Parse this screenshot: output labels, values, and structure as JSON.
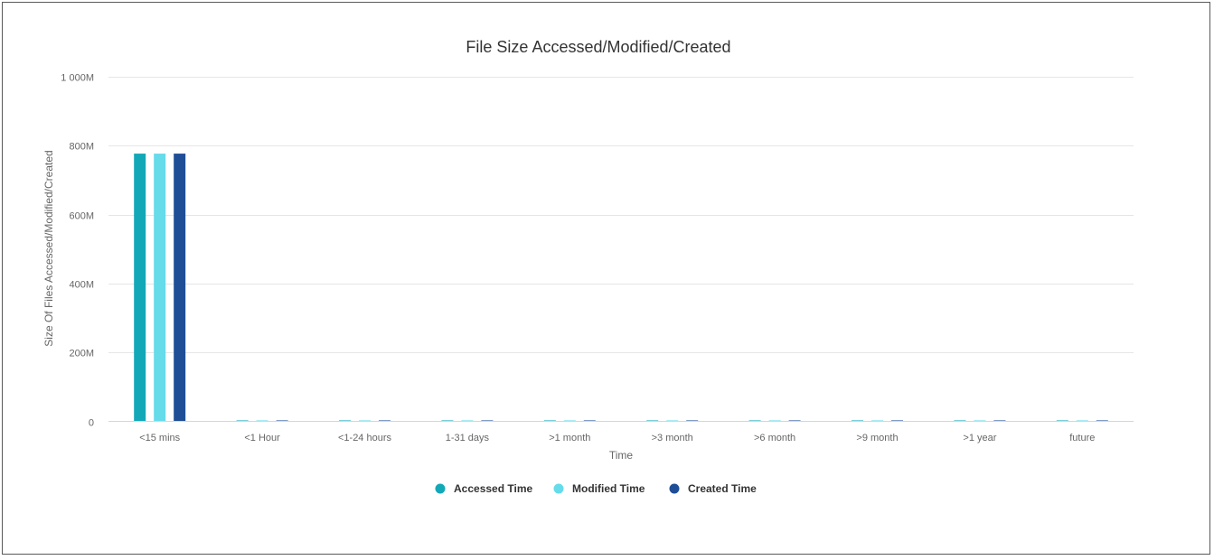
{
  "chart_data": {
    "type": "bar",
    "title": "File Size Accessed/Modified/Created",
    "xlabel": "Time",
    "ylabel": "Size Of Files Accessed/Modified/Created",
    "categories": [
      "<15 mins",
      "<1 Hour",
      "<1-24 hours",
      "1-31 days",
      ">1 month",
      ">3 month",
      ">6 month",
      ">9 month",
      ">1 year",
      "future"
    ],
    "series": [
      {
        "name": "Accessed Time",
        "color": "#13a8b8",
        "values": [
          777,
          0,
          0,
          0,
          0,
          0,
          0,
          0,
          0,
          0
        ]
      },
      {
        "name": "Modified Time",
        "color": "#66dbea",
        "values": [
          777,
          0,
          0,
          0,
          0,
          0,
          0,
          0,
          0,
          0
        ]
      },
      {
        "name": "Created Time",
        "color": "#1f4e96",
        "values": [
          777,
          0,
          0,
          0,
          0,
          0,
          0,
          0,
          0,
          0
        ]
      }
    ],
    "ylim": [
      0,
      1000
    ],
    "yticks": [
      0,
      200,
      400,
      600,
      800,
      1000
    ],
    "ytick_labels": [
      "0",
      "200M",
      "400M",
      "600M",
      "800M",
      "1 000M"
    ],
    "grid": true,
    "legend_position": "bottom-center"
  }
}
